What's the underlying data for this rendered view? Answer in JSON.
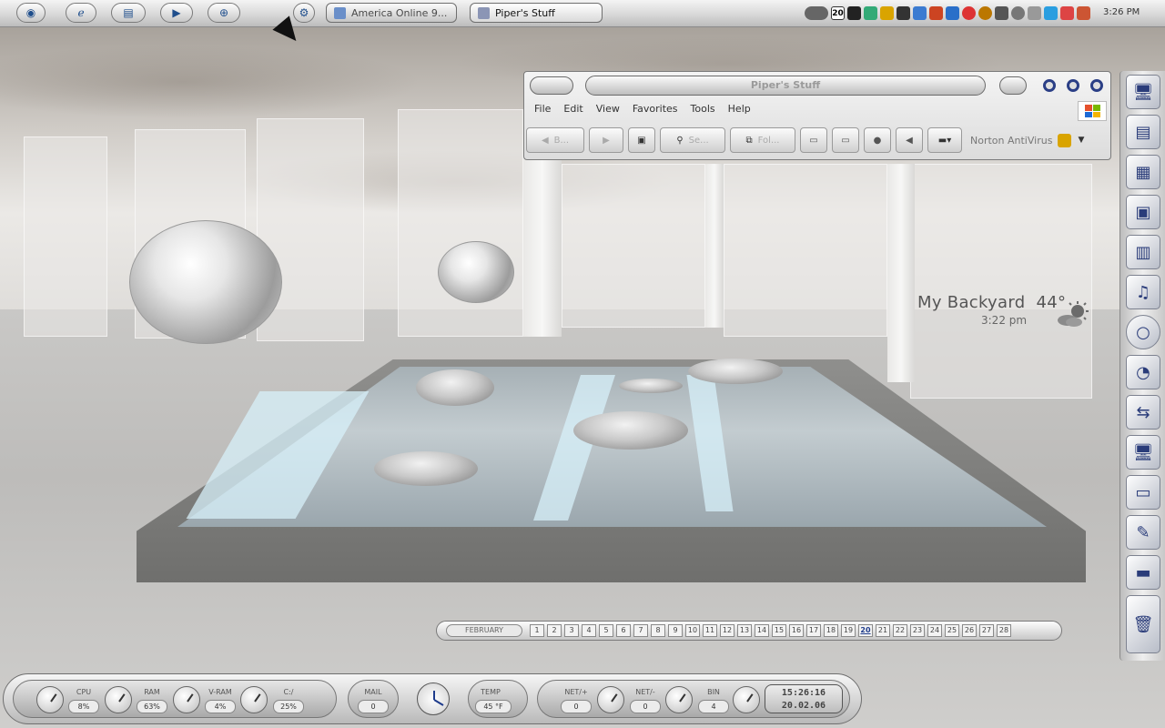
{
  "taskbar": {
    "buttons": [
      {
        "label": "America Online 9...",
        "icon": "aol-icon",
        "active": false
      },
      {
        "label": "Piper's Stuff",
        "icon": "folder-icon",
        "active": true
      }
    ],
    "clock": "3:26 PM",
    "tray_date": "20"
  },
  "explorer": {
    "title": "Piper's Stuff",
    "menu": [
      "File",
      "Edit",
      "View",
      "Favorites",
      "Tools",
      "Help"
    ],
    "toolbar": {
      "back": "B...",
      "search": "Se...",
      "folders": "Fol...",
      "norton": "Norton AntiVirus"
    }
  },
  "weather": {
    "location": "My Backyard",
    "temperature": "44°",
    "time": "3:22 pm"
  },
  "calendar": {
    "month": "FEBRUARY",
    "days": [
      "1",
      "2",
      "3",
      "4",
      "5",
      "6",
      "7",
      "8",
      "9",
      "10",
      "11",
      "12",
      "13",
      "14",
      "15",
      "16",
      "17",
      "18",
      "19",
      "20",
      "21",
      "22",
      "23",
      "24",
      "25",
      "26",
      "27",
      "28"
    ],
    "today": "20"
  },
  "monitor": {
    "cpu_label": "CPU",
    "cpu_value": "8%",
    "ram_label": "RAM",
    "ram_value": "63%",
    "vram_label": "V-RAM",
    "vram_value": "4%",
    "disk_label": "C:/",
    "disk_value": "25%",
    "mail_label": "MAIL",
    "mail_value": "0",
    "temp_label": "TEMP",
    "temp_value": "45 °F",
    "netin_label": "NET/+",
    "netin_value": "0",
    "netout_label": "NET/-",
    "netout_value": "0",
    "bin_label": "BIN",
    "bin_value": "4",
    "time": "15:26:16",
    "date": "20.02.06"
  }
}
